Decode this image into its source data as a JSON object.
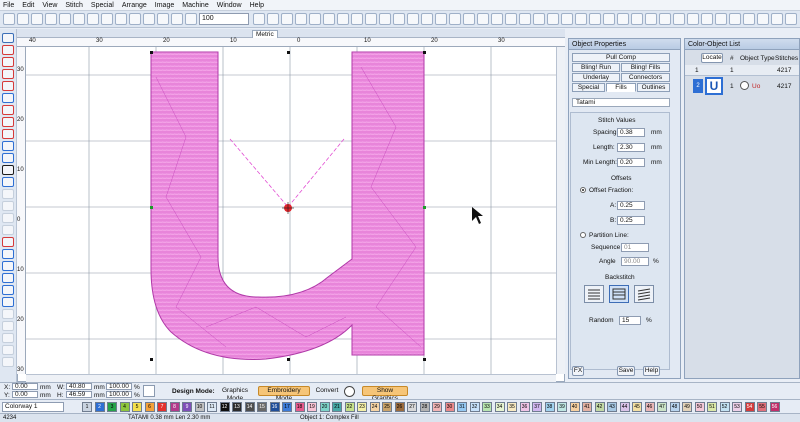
{
  "menu": [
    "File",
    "Edit",
    "View",
    "Stitch",
    "Special",
    "Arrange",
    "Image",
    "Machine",
    "Window",
    "Help"
  ],
  "toolbar": {
    "zoom": "100"
  },
  "canvas": {
    "tab": "Metric"
  },
  "ruler": {
    "h_labels": [
      "40",
      "30",
      "20",
      "10",
      "0",
      "10",
      "20",
      "30"
    ],
    "v_labels": [
      "30",
      "20",
      "10",
      "0",
      "10",
      "20",
      "30"
    ]
  },
  "props": {
    "title": "Object Properties",
    "tabs": {
      "pull_comp": "Pull Comp",
      "bling_run": "Bling! Run",
      "bling_fills": "Bling! Fills",
      "underlay": "Underlay",
      "connectors": "Connectors",
      "special": "Special",
      "fills": "Fills",
      "outlines": "Outlines"
    },
    "fill_type": "Tatami",
    "stitch_values": {
      "heading": "Stitch Values",
      "spacing_label": "Spacing:",
      "spacing": "0.38",
      "length_label": "Length:",
      "length": "2.30",
      "min_length_label": "Min Length:",
      "min_length": "0.20",
      "unit": "mm"
    },
    "offsets": {
      "heading": "Offsets",
      "offset_fraction": "Offset Fraction:",
      "a_label": "A:",
      "a": "0.25",
      "b_label": "B:",
      "b": "0.25",
      "partition_line": "Partition Line:",
      "sequence_label": "Sequence",
      "sequence": "01",
      "angle_label": "Angle",
      "angle": "90.00",
      "angle_unit": "%"
    },
    "backstitch": {
      "heading": "Backstitch"
    },
    "random_label": "Random",
    "random": "15",
    "random_unit": "%",
    "fx": "FX",
    "save": "Save",
    "help": "Help"
  },
  "colorlist": {
    "title": "Color-Object List",
    "locate": "Locate",
    "cols": [
      "#",
      "Object Type",
      "Stitches"
    ],
    "rows": [
      {
        "num": "1",
        "swatch_num": "2",
        "obj": "1",
        "stitches": "4217",
        "label": "Uo"
      },
      {
        "num": "1",
        "obj": "1",
        "stitches": "4217"
      }
    ]
  },
  "bottom": {
    "x_label": "X:",
    "x": "0.00",
    "y_label": "Y:",
    "y": "0.00",
    "w_label": "W:",
    "w": "40.80",
    "h_label": "H:",
    "h": "46.59",
    "mm": "mm",
    "pct1": "100.00",
    "pct2": "100.00",
    "pct": "%",
    "design_mode": "Design Mode:",
    "graphics_mode": "Graphics Mode",
    "embroidery_mode": "Embroidery Mode",
    "convert": "Convert",
    "show_graphics": "Show Graphics"
  },
  "colorway": {
    "label": "Colorway 1",
    "swatches": [
      "1",
      "2",
      "3",
      "4",
      "5",
      "6",
      "7",
      "8",
      "9",
      "10",
      "11",
      "12",
      "13",
      "14",
      "15",
      "16",
      "17",
      "18",
      "19",
      "20",
      "21",
      "22",
      "23",
      "24",
      "25",
      "26",
      "27",
      "28",
      "29",
      "30",
      "31",
      "32",
      "33",
      "34",
      "35",
      "36",
      "37",
      "38",
      "39",
      "40",
      "41",
      "42",
      "43",
      "44",
      "45",
      "46",
      "47",
      "48",
      "49",
      "50",
      "51",
      "52",
      "53",
      "54",
      "55",
      "56"
    ],
    "colors": [
      "#c9d3e0",
      "#2e6fd4",
      "#26a34a",
      "#8ec63f",
      "#f4e04d",
      "#f3a13a",
      "#e3312d",
      "#b23a8a",
      "#7f4fb8",
      "#c0c0c0",
      "#dce8f4",
      "#0f0f0f",
      "#2b2b2b",
      "#4d4d4d",
      "#696969",
      "#1f4e99",
      "#3b7bd9",
      "#e65b8b",
      "#f9c3d4",
      "#7dd3c8",
      "#48a9a6",
      "#c6e08a",
      "#f4f0a8",
      "#f6d4a5",
      "#c9a36b",
      "#9b6b3d",
      "#d9d9d9",
      "#b3b3b3",
      "#f2b5b5",
      "#ea8a8a",
      "#95c9f2",
      "#c7e1fa",
      "#b7e4b0",
      "#e7f4d1",
      "#f8eac2",
      "#efc4e6",
      "#d1b7ef",
      "#a2d2ee",
      "#bfe6e2",
      "#f7d1a1",
      "#e3b2a4",
      "#c3d9a5",
      "#a7c8e3",
      "#d9c4e8",
      "#f3dfa3",
      "#e8b6b6",
      "#cbe3c7",
      "#b8d4ef",
      "#e2d2b9",
      "#f5c9d8",
      "#dbe9a9",
      "#c2e1f2",
      "#edd0e8",
      "#d43b3b",
      "#e1707b",
      "#c22e6a"
    ]
  },
  "status": {
    "code": "4234",
    "info": "TATAMI 0.38 mm Len 2.30 mm",
    "object": "Object 1: Complex Fill"
  },
  "accent": "#f08fdc"
}
